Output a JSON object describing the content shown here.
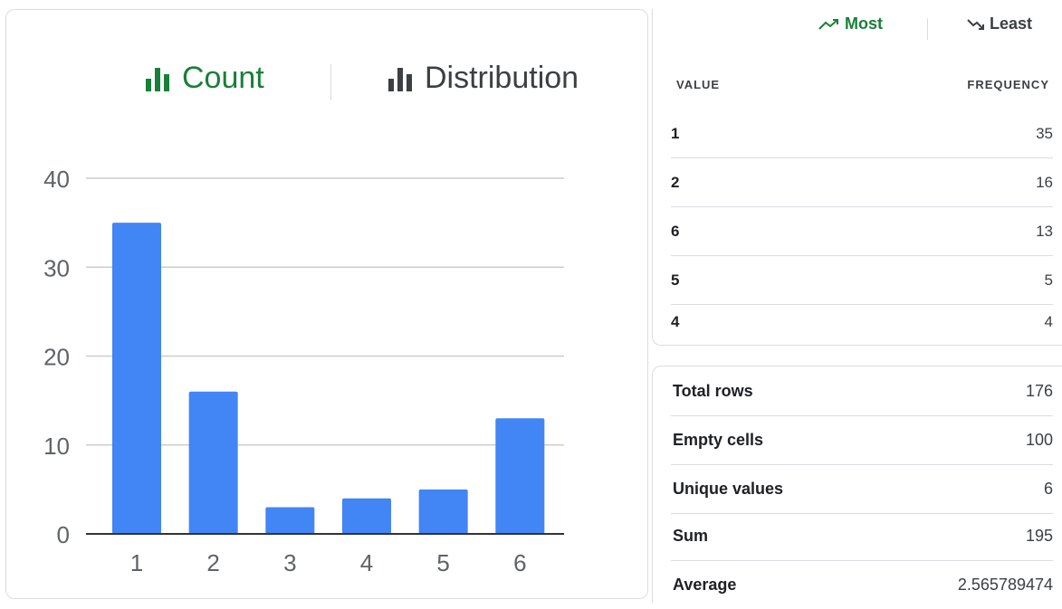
{
  "toggles": {
    "count_label": "Count",
    "distribution_label": "Distribution",
    "active_color": "#188038",
    "inactive_color": "#3c4043"
  },
  "chart_data": {
    "type": "bar",
    "categories": [
      "1",
      "2",
      "3",
      "4",
      "5",
      "6"
    ],
    "values": [
      35,
      16,
      3,
      4,
      5,
      13
    ],
    "yticks": [
      0,
      10,
      20,
      30,
      40
    ],
    "ylim": [
      0,
      40
    ],
    "grid": true,
    "bar_color": "#4285f4"
  },
  "frequency": {
    "sort_most_label": "Most",
    "sort_least_label": "Least",
    "col_value": "VALUE",
    "col_frequency": "FREQUENCY",
    "rows": [
      {
        "value": "1",
        "freq": "35"
      },
      {
        "value": "2",
        "freq": "16"
      },
      {
        "value": "6",
        "freq": "13"
      },
      {
        "value": "5",
        "freq": "5"
      },
      {
        "value": "4",
        "freq": "4"
      }
    ]
  },
  "stats": [
    {
      "label": "Total rows",
      "value": "176"
    },
    {
      "label": "Empty cells",
      "value": "100"
    },
    {
      "label": "Unique values",
      "value": "6"
    },
    {
      "label": "Sum",
      "value": "195"
    },
    {
      "label": "Average",
      "value": "2.565789474"
    }
  ]
}
